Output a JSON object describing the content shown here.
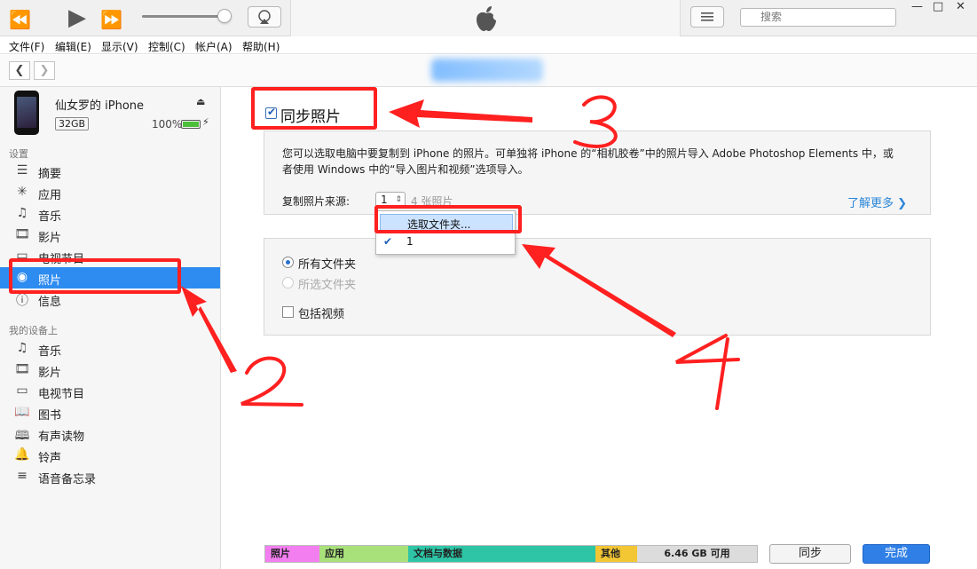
{
  "toolbar": {
    "search_placeholder": "搜索"
  },
  "menu": [
    "文件(F)",
    "编辑(E)",
    "显示(V)",
    "控制(C)",
    "帐户(A)",
    "帮助(H)"
  ],
  "device": {
    "name": "仙女罗的 iPhone",
    "capacity": "32GB",
    "battery_pct": "100%",
    "battery_level": 1.0
  },
  "sidebar": {
    "settings_header": "设置",
    "settings_items": [
      {
        "label": "摘要",
        "icon": "summary-icon"
      },
      {
        "label": "应用",
        "icon": "apps-icon"
      },
      {
        "label": "音乐",
        "icon": "music-icon"
      },
      {
        "label": "影片",
        "icon": "film-icon"
      },
      {
        "label": "电视节目",
        "icon": "tv-icon"
      },
      {
        "label": "照片",
        "icon": "camera-icon"
      },
      {
        "label": "信息",
        "icon": "info-icon"
      }
    ],
    "ondevice_header": "我的设备上",
    "ondevice_items": [
      {
        "label": "音乐",
        "icon": "music-icon"
      },
      {
        "label": "影片",
        "icon": "film-icon"
      },
      {
        "label": "电视节目",
        "icon": "tv-icon"
      },
      {
        "label": "图书",
        "icon": "book-icon"
      },
      {
        "label": "有声读物",
        "icon": "audiobook-icon"
      },
      {
        "label": "铃声",
        "icon": "bell-icon"
      },
      {
        "label": "语音备忘录",
        "icon": "voice-memo-icon"
      }
    ]
  },
  "photos": {
    "sync_title": "同步照片",
    "sync_checked": true,
    "description": "您可以选取电脑中要复制到 iPhone 的照片。可单独将 iPhone 的“相机胶卷”中的照片导入 Adobe Photoshop Elements 中，或者使用 Windows 中的“导入图片和视频”选项导入。",
    "source_label": "复制照片来源:",
    "source_value": "1",
    "photo_count": "4 张照片",
    "learn_more": "了解更多",
    "dropdown": {
      "item_choose": "选取文件夹...",
      "item_current": "1"
    },
    "options": {
      "all_folders": "所有文件夹",
      "selected_folders": "所选文件夹",
      "include_video": "包括视频"
    }
  },
  "storage": {
    "segments": [
      {
        "label": "照片",
        "color": "#f27ef0",
        "fraction": 0.11
      },
      {
        "label": "应用",
        "color": "#a8e07a",
        "fraction": 0.18
      },
      {
        "label": "文档与数据",
        "color": "#2dc5a6",
        "fraction": 0.38
      },
      {
        "label": "其他",
        "color": "#f3c633",
        "fraction": 0.085
      }
    ],
    "free_label": "6.46 GB 可用"
  },
  "buttons": {
    "sync": "同步",
    "done": "完成"
  },
  "annotations": {
    "numbers": [
      "2",
      "3",
      "4"
    ],
    "color": "#ff2020"
  },
  "colors": {
    "accent": "#2e8cf0",
    "link": "#2a86d8"
  }
}
